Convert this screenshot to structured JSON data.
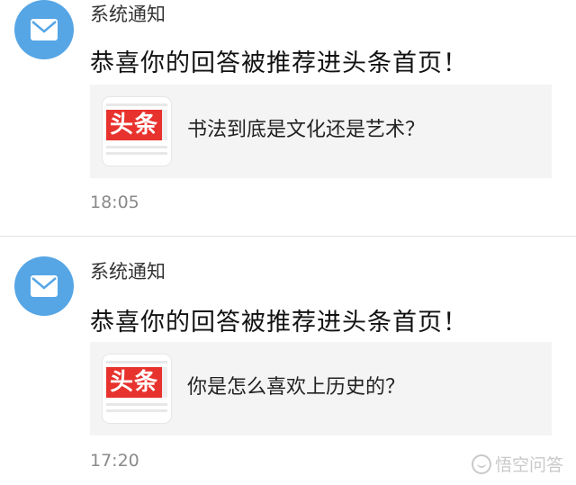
{
  "notifications": [
    {
      "sender": "系统通知",
      "message": "恭喜你的回答被推荐进头条首页！",
      "card": {
        "logo_text": "头条",
        "title": "书法到底是文化还是艺术？"
      },
      "time": "18:05"
    },
    {
      "sender": "系统通知",
      "message": "恭喜你的回答被推荐进头条首页！",
      "card": {
        "logo_text": "头条",
        "title": "你是怎么喜欢上历史的？"
      },
      "time": "17:20"
    }
  ],
  "watermark": "悟空问答",
  "colors": {
    "avatar": "#56a6e6",
    "logo_red": "#e8322d",
    "card_bg": "#f4f4f4"
  },
  "icons": {
    "avatar": "envelope-icon",
    "watermark": "wukong-icon"
  }
}
